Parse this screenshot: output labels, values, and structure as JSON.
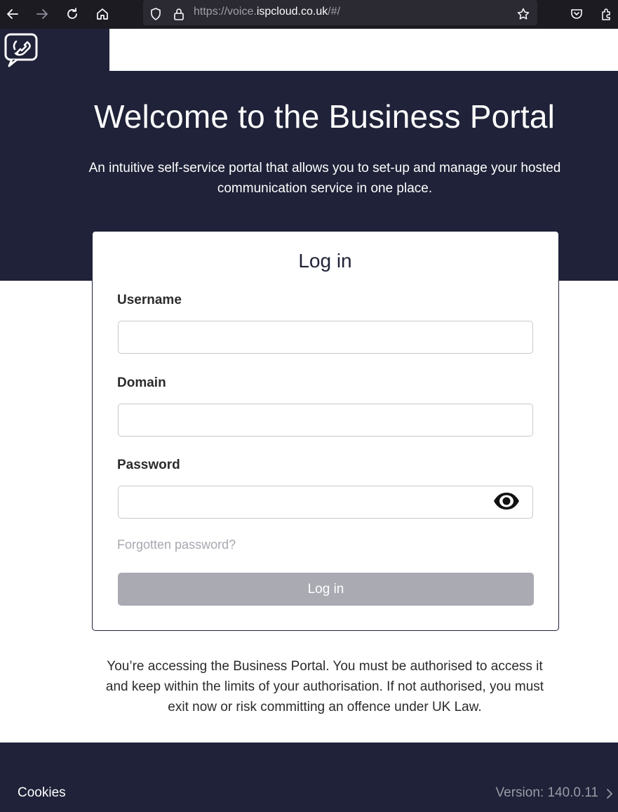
{
  "browser": {
    "url_prefix": "https://voice.",
    "url_host": "ispcloud.co.uk",
    "url_rest": "/#/",
    "icons": [
      "back-arrow-icon",
      "forward-arrow-icon",
      "reload-icon",
      "home-icon",
      "shield-icon",
      "lock-icon",
      "star-icon",
      "pocket-icon",
      "extensions-icon"
    ]
  },
  "header": {
    "logo_icon": "phone-handset-icon"
  },
  "hero": {
    "title": "Welcome to the Business Portal",
    "subtitle_line1": "An intuitive self-service portal that allows you to set-up and manage your hosted",
    "subtitle_line2": "communication service in one place."
  },
  "login": {
    "title": "Log in",
    "username_label": "Username",
    "username_value": "",
    "domain_label": "Domain",
    "domain_value": "",
    "password_label": "Password",
    "password_value": "",
    "show_password_icon": "eye-icon",
    "forgot_link": "Forgotten password?",
    "submit_label": "Log in"
  },
  "notice": {
    "line1": "You’re accessing the Business Portal. You must be authorised to access it",
    "line2": "and keep within the limits of your authorisation. If not authorised, you must",
    "line3": "exit now or risk committing an offence under UK Law."
  },
  "footer": {
    "cookies_label": "Cookies",
    "version_text": "Version: 140.0.11"
  },
  "colors": {
    "brand_navy": "#1f2238",
    "button_disabled": "#aaaab3",
    "link_muted": "#a7a7b0"
  }
}
